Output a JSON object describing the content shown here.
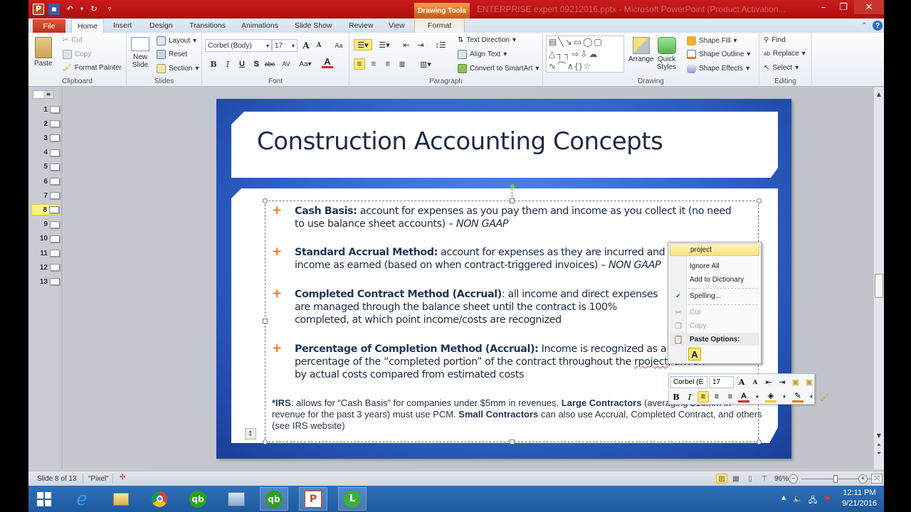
{
  "window": {
    "title": "ENTERPRISE expert 09212016.pptx - Microsoft PowerPoint (Product Activation...",
    "contextual_tab_group": "Drawing Tools"
  },
  "tabs": [
    {
      "label": "File"
    },
    {
      "label": "Home",
      "active": true
    },
    {
      "label": "Insert"
    },
    {
      "label": "Design"
    },
    {
      "label": "Transitions"
    },
    {
      "label": "Animations"
    },
    {
      "label": "Slide Show"
    },
    {
      "label": "Review"
    },
    {
      "label": "View"
    },
    {
      "label": "Format"
    }
  ],
  "ribbon": {
    "clipboard": {
      "label": "Clipboard",
      "paste": "Paste",
      "cut": "Cut",
      "copy": "Copy",
      "format_painter": "Format Painter"
    },
    "slides": {
      "label": "Slides",
      "new_slide_1": "New",
      "new_slide_2": "Slide",
      "layout": "Layout",
      "reset": "Reset",
      "section": "Section"
    },
    "font": {
      "label": "Font",
      "font_name": "Corbel (Body)",
      "font_size": "17"
    },
    "paragraph": {
      "label": "Paragraph",
      "text_direction": "Text Direction",
      "align_text": "Align Text",
      "convert_smartart": "Convert to SmartArt"
    },
    "drawing": {
      "label": "Drawing",
      "arrange": "Arrange",
      "quick_styles_1": "Quick",
      "quick_styles_2": "Styles",
      "shape_fill": "Shape Fill",
      "shape_outline": "Shape Outline",
      "shape_effects": "Shape Effects"
    },
    "editing": {
      "label": "Editing",
      "find": "Find",
      "replace": "Replace",
      "select": "Select"
    }
  },
  "thumbnails": {
    "count": 13,
    "selected": 8,
    "items": [
      "1",
      "2",
      "3",
      "4",
      "5",
      "6",
      "7",
      "8",
      "9",
      "10",
      "11",
      "12",
      "13"
    ]
  },
  "slide": {
    "title": "Construction Accounting Concepts",
    "bullets": [
      {
        "bold": "Cash Basis:",
        "text": " account for expenses as you pay them and income as you collect it (no need to use balance sheet accounts) – ",
        "italic": "NON GAAP"
      },
      {
        "bold": "Standard Accrual Method:",
        "text": " account for expenses as they are incurred and income as earned (based on when contract-triggered invoices) – ",
        "italic": "NON GAAP"
      },
      {
        "bold": "Completed Contract Method (Accrual)",
        "text": ": all income and direct expenses are managed through the balance sheet until the contract is 100% completed, at which point income/costs are recognized",
        "italic": ""
      },
      {
        "bold": "Percentage of Completion Method (Accrual):",
        "text": " Income is recognized as a percentage of the “completed portion” of the contract throughout the ",
        "misspelled": "rpoject,",
        "after": " driven by actual costs compared from estimated costs"
      }
    ],
    "irs_note": {
      "b1": "*IRS",
      "t1": ": allows for “Cash Basis” for companies under $5mm in revenues.  ",
      "b2": "Large Contractors",
      "t2": " (averaging $10mm in revenue for the past 3 years) must use PCM.  ",
      "b3": "Small Contractors",
      "t3": " can also use Accrual, Completed Contract, and others (see IRS website)"
    }
  },
  "context_menu": {
    "items": [
      {
        "label": "project",
        "highlighted": true
      },
      {
        "label": "Ignore All"
      },
      {
        "label": "Add to Dictionary"
      },
      {
        "label": "Spelling..."
      },
      {
        "label": "Cut",
        "disabled": true
      },
      {
        "label": "Copy",
        "disabled": true
      },
      {
        "label": "Paste Options:"
      }
    ],
    "paste_option": "A"
  },
  "mini_toolbar": {
    "font_name": "Corbel (E",
    "font_size": "17"
  },
  "status": {
    "slide_indicator": "Slide 8 of 13",
    "theme": "\"Pixel\"",
    "zoom": "96%",
    "zoom_percent": 96
  },
  "taskbar": {
    "time": "12:11 PM",
    "date": "9/21/2016"
  }
}
